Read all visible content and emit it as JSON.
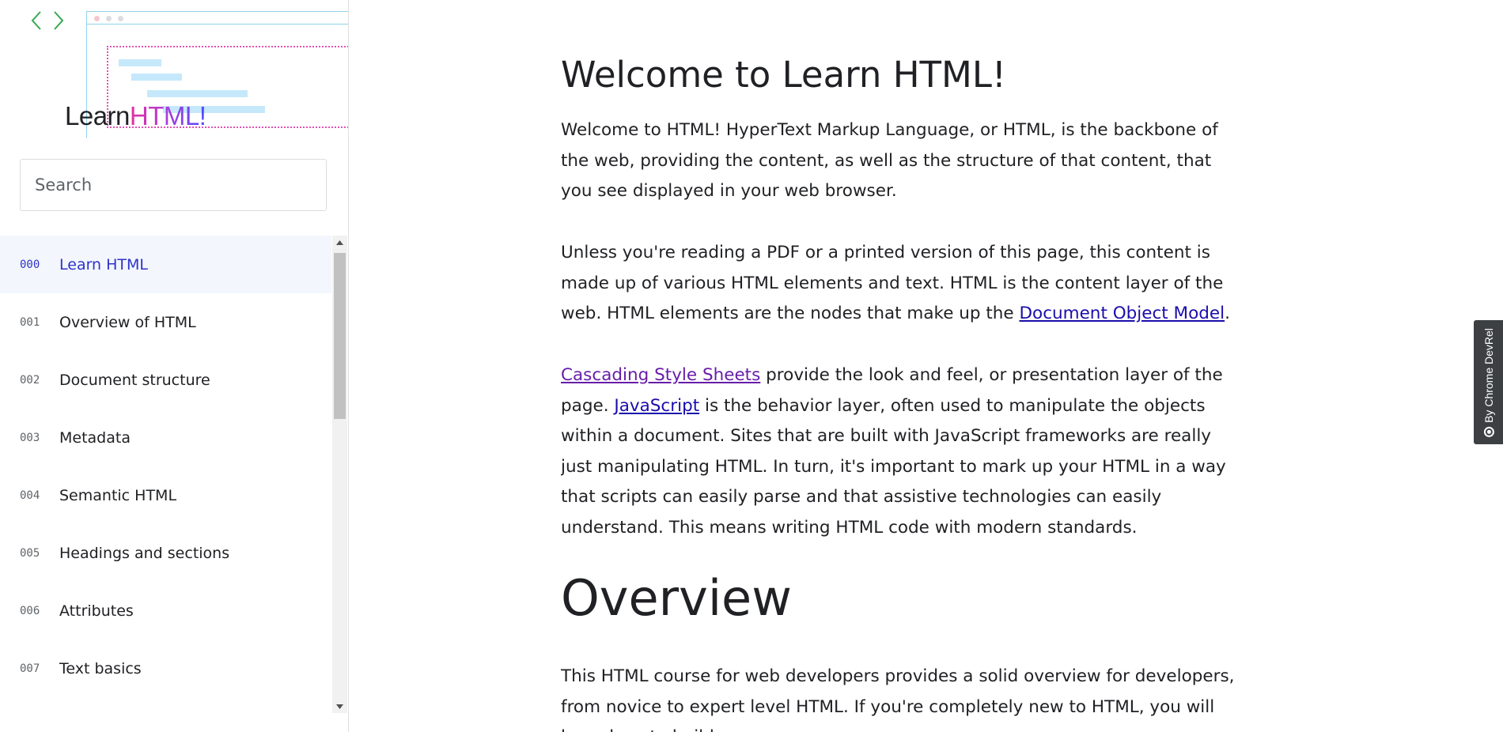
{
  "sidebar": {
    "logo": {
      "prefix": "Learn",
      "accent": "HTML!"
    },
    "search": {
      "placeholder": "Search",
      "value": ""
    },
    "items": [
      {
        "num": "000",
        "label": "Learn HTML",
        "active": true
      },
      {
        "num": "001",
        "label": "Overview of HTML"
      },
      {
        "num": "002",
        "label": "Document structure"
      },
      {
        "num": "003",
        "label": "Metadata"
      },
      {
        "num": "004",
        "label": "Semantic HTML"
      },
      {
        "num": "005",
        "label": "Headings and sections"
      },
      {
        "num": "006",
        "label": "Attributes"
      },
      {
        "num": "007",
        "label": "Text basics"
      }
    ]
  },
  "main": {
    "title": "Welcome to Learn HTML!",
    "p1": "Welcome to HTML! HyperText Markup Language, or HTML, is the backbone of the web, providing the content, as well as the structure of that content, that you see displayed in your web browser.",
    "p2": {
      "before": "Unless you're reading a PDF or a printed version of this page, this content is made up of various HTML elements and text. HTML is the content layer of the web. HTML elements are the nodes that make up the ",
      "link": "Document Object Model",
      "after": "."
    },
    "p3": {
      "link1": "Cascading Style Sheets",
      "text1": " provide the look and feel, or presentation layer of the page. ",
      "link2": "JavaScript",
      "text2": " is the behavior layer, often used to manipulate the objects within a document. Sites that are built with JavaScript frameworks are really just manipulating HTML. In turn, it's important to mark up your HTML in a way that scripts can easily parse and that assistive technologies can easily understand. This means writing HTML code with modern standards."
    },
    "overview_title": "Overview",
    "p4": "This HTML course for web developers provides a solid overview for developers, from novice to expert level HTML. If you're completely new to HTML, you will learn how to build"
  },
  "badge": {
    "text": "By Chrome DevRel",
    "icon": "chrome-icon"
  },
  "colors": {
    "accent_link": "#1a0dab",
    "visited_link": "#681da8",
    "active_nav": "#2e33c9",
    "active_nav_bg": "#f3f6fd",
    "arrow_green": "#34a853"
  }
}
